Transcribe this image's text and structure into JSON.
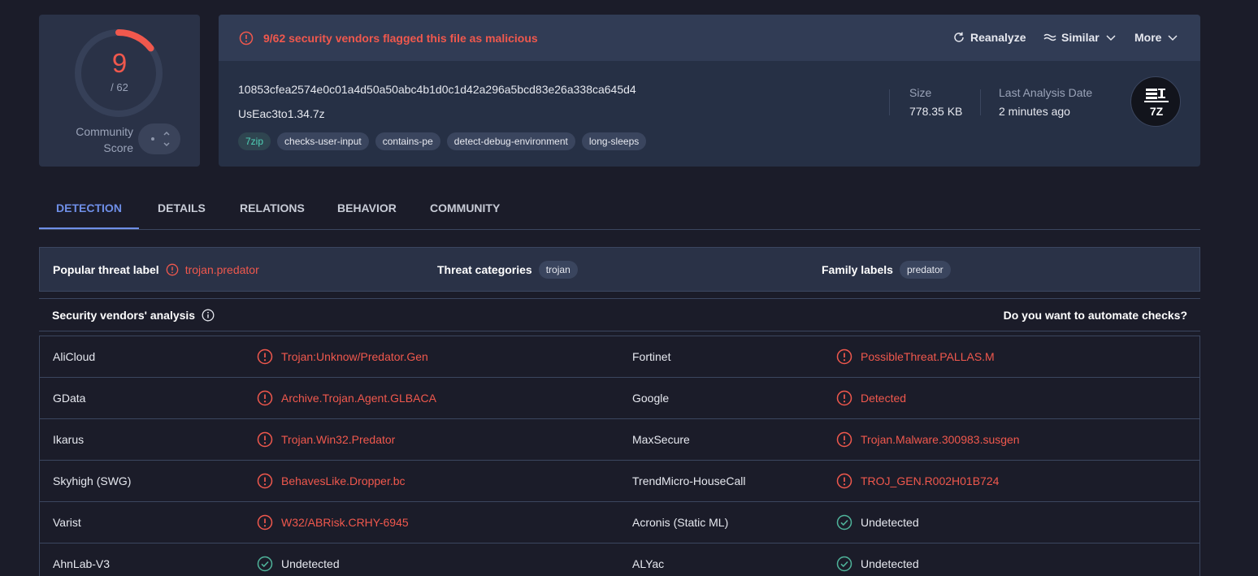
{
  "score": {
    "detections": "9",
    "total": "/ 62",
    "community_label": "Community Score",
    "fraction": 0.145
  },
  "alert": {
    "text": "9/62 security vendors flagged this file as malicious"
  },
  "actions": {
    "reanalyze": "Reanalyze",
    "similar": "Similar",
    "more": "More"
  },
  "file": {
    "hash": "10853cfea2574e0c01a4d50a50abc4b1d0c1d42a296a5bcd83e26a338ca645d4",
    "name": "UsEac3to1.34.7z",
    "tags": [
      "7zip",
      "checks-user-input",
      "contains-pe",
      "detect-debug-environment",
      "long-sleeps"
    ],
    "size_label": "Size",
    "size_value": "778.35 KB",
    "date_label": "Last Analysis Date",
    "date_value": "2 minutes ago",
    "type_icon_text": "7Z"
  },
  "tabs": [
    "DETECTION",
    "DETAILS",
    "RELATIONS",
    "BEHAVIOR",
    "COMMUNITY"
  ],
  "threat": {
    "popular_label": "Popular threat label",
    "popular_value": "trojan.predator",
    "categories_label": "Threat categories",
    "categories_value": "trojan",
    "family_label": "Family labels",
    "family_value": "predator"
  },
  "analysis": {
    "title": "Security vendors' analysis",
    "automate": "Do you want to automate checks?"
  },
  "vendors": [
    [
      {
        "name": "AliCloud",
        "result": "Trojan:Unknow/Predator.Gen",
        "status": "malicious"
      },
      {
        "name": "Fortinet",
        "result": "PossibleThreat.PALLAS.M",
        "status": "malicious"
      }
    ],
    [
      {
        "name": "GData",
        "result": "Archive.Trojan.Agent.GLBACA",
        "status": "malicious"
      },
      {
        "name": "Google",
        "result": "Detected",
        "status": "malicious"
      }
    ],
    [
      {
        "name": "Ikarus",
        "result": "Trojan.Win32.Predator",
        "status": "malicious"
      },
      {
        "name": "MaxSecure",
        "result": "Trojan.Malware.300983.susgen",
        "status": "malicious"
      }
    ],
    [
      {
        "name": "Skyhigh (SWG)",
        "result": "BehavesLike.Dropper.bc",
        "status": "malicious"
      },
      {
        "name": "TrendMicro-HouseCall",
        "result": "TROJ_GEN.R002H01B724",
        "status": "malicious"
      }
    ],
    [
      {
        "name": "Varist",
        "result": "W32/ABRisk.CRHY-6945",
        "status": "malicious"
      },
      {
        "name": "Acronis (Static ML)",
        "result": "Undetected",
        "status": "undetected"
      }
    ],
    [
      {
        "name": "AhnLab-V3",
        "result": "Undetected",
        "status": "undetected"
      },
      {
        "name": "ALYac",
        "result": "Undetected",
        "status": "undetected"
      }
    ]
  ],
  "colors": {
    "malicious": "#f0584d",
    "undetected": "#4fb39a",
    "accent": "#6f8fe8"
  }
}
